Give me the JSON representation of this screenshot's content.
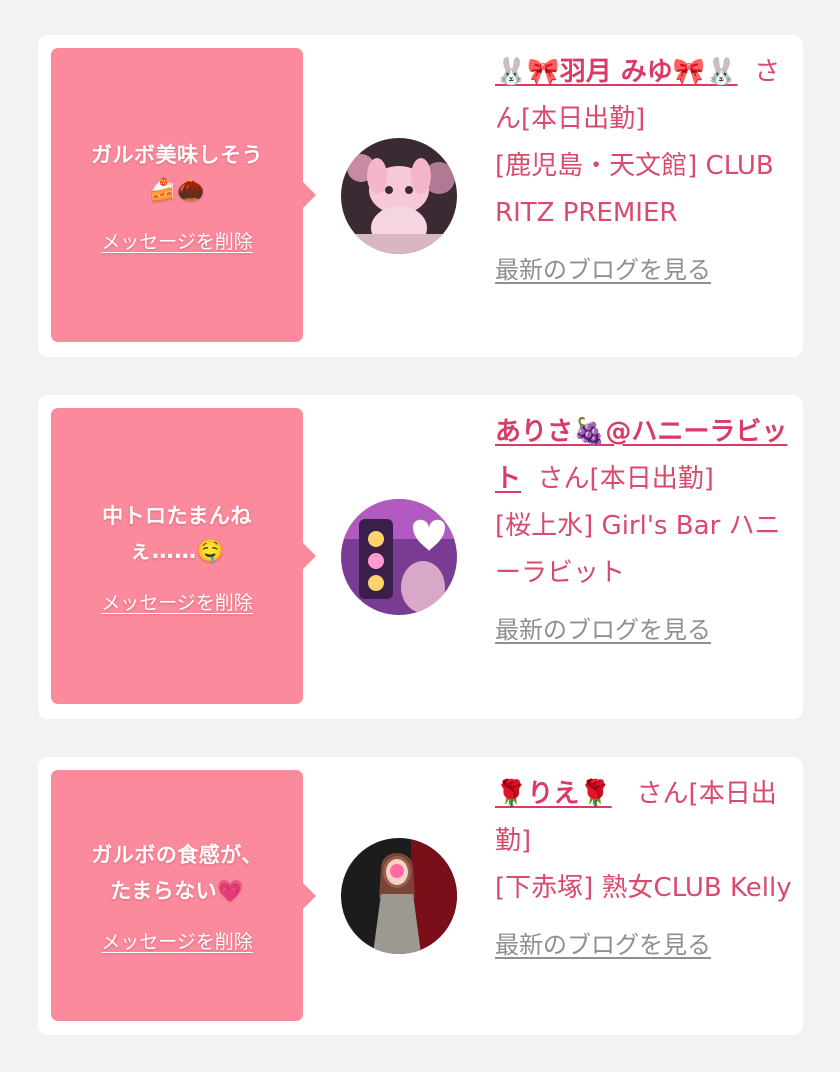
{
  "colors": {
    "page_bg": "#f2f2f2",
    "card_bg": "#ffffff",
    "bubble_bg": "#fb8a9c",
    "accent_text": "#d94a6c",
    "link_gray": "#8f8f8f"
  },
  "delete_label": "メッセージを削除",
  "blog_label": "最新のブログを見る",
  "san_suffix": "さん[本日出勤]",
  "cards": [
    {
      "message_line1": "ガルボ美味しそう",
      "message_line2": "🍰🌰",
      "name": "🐰🎀羽月 みゆ🎀🐰",
      "shop": "[鹿児島・天文館] CLUB RITZ PREMIER",
      "avatar_icon": "pink-plush-toy-icon"
    },
    {
      "message_line1": "中トロたまんね",
      "message_line2": "ぇ……🤤",
      "name": "ありさ🍇@ハニーラビット",
      "shop": "[桜上水] Girl's Bar ハニーラビット",
      "avatar_icon": "neon-sign-photo-icon"
    },
    {
      "message_line1": "ガルボの食感が、",
      "message_line2": "たまらない💗",
      "name": "🌹りえ🌹",
      "shop": "[下赤塚] 熟女CLUB Kelly",
      "avatar_icon": "woman-in-dress-photo-icon"
    }
  ]
}
